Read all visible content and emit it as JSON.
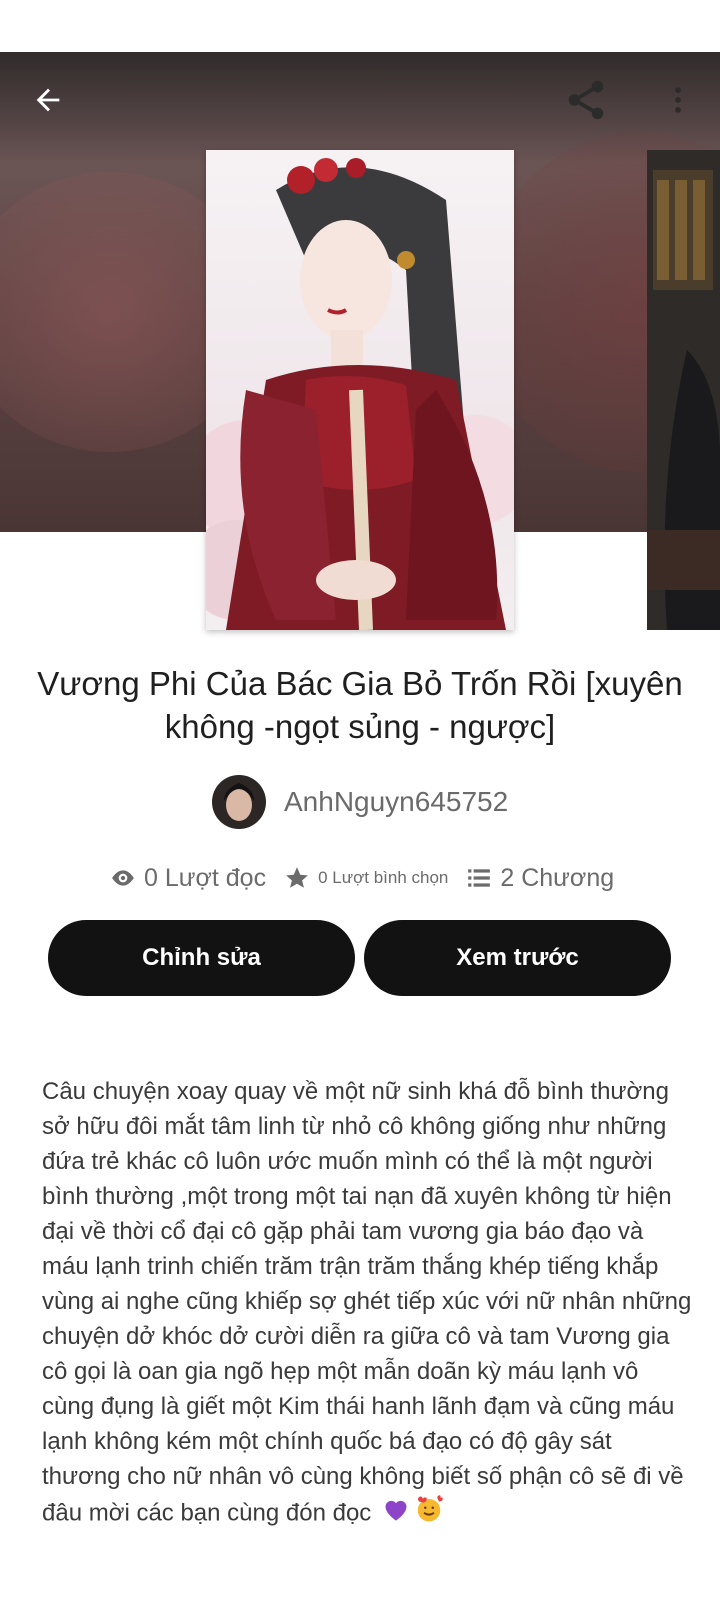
{
  "story": {
    "title": "Vương Phi Của Bác Gia Bỏ Trốn Rồi [xuyên không -ngọt sủng - ngược]",
    "author": "AnhNguyn645752",
    "reads_text": "0 Lượt đọc",
    "votes_text": "0 Lượt bình chọn",
    "parts_text": "2 Chương",
    "description": "Câu chuyện xoay quay về một nữ sinh khá đỗ bình thường sở hữu đôi mắt tâm linh từ nhỏ cô không giống như những đứa trẻ khác cô luôn ước muốn mình có thể là một người bình thường ,một trong một tai nạn đã xuyên không từ hiện đại về thời cổ đại cô gặp phải tam vương gia báo đạo và máu lạnh trinh chiến trăm trận trăm thắng khép tiếng khắp vùng ai nghe cũng khiếp sợ  ghét tiếp xúc với nữ nhân những chuyện dở khóc dở cười diễn ra giữa cô và tam Vương gia cô gọi là oan gia ngõ hẹp một mẫn doãn kỳ máu lạnh vô cùng đụng là giết  một Kim thái hanh lãnh đạm và cũng máu lạnh không kém một chính quốc bá đạo có độ gây sát thương cho nữ nhân vô cùng không biết số phận cô sẽ đi về đâu mời các bạn cùng đón đọc"
  },
  "actions": {
    "edit_label": "Chỉnh sửa",
    "preview_label": "Xem trước"
  },
  "icons": {
    "back": "arrow-left-icon",
    "share": "share-icon",
    "more": "more-vertical-icon",
    "reads": "eye-icon",
    "votes": "star-icon",
    "parts": "list-icon",
    "emoji1": "purple-heart-emoji",
    "emoji2": "smiling-face-with-hearts-emoji"
  },
  "colors": {
    "button_bg": "#121212",
    "text_primary": "#1f1f1f",
    "text_secondary": "#6b6b6b"
  }
}
